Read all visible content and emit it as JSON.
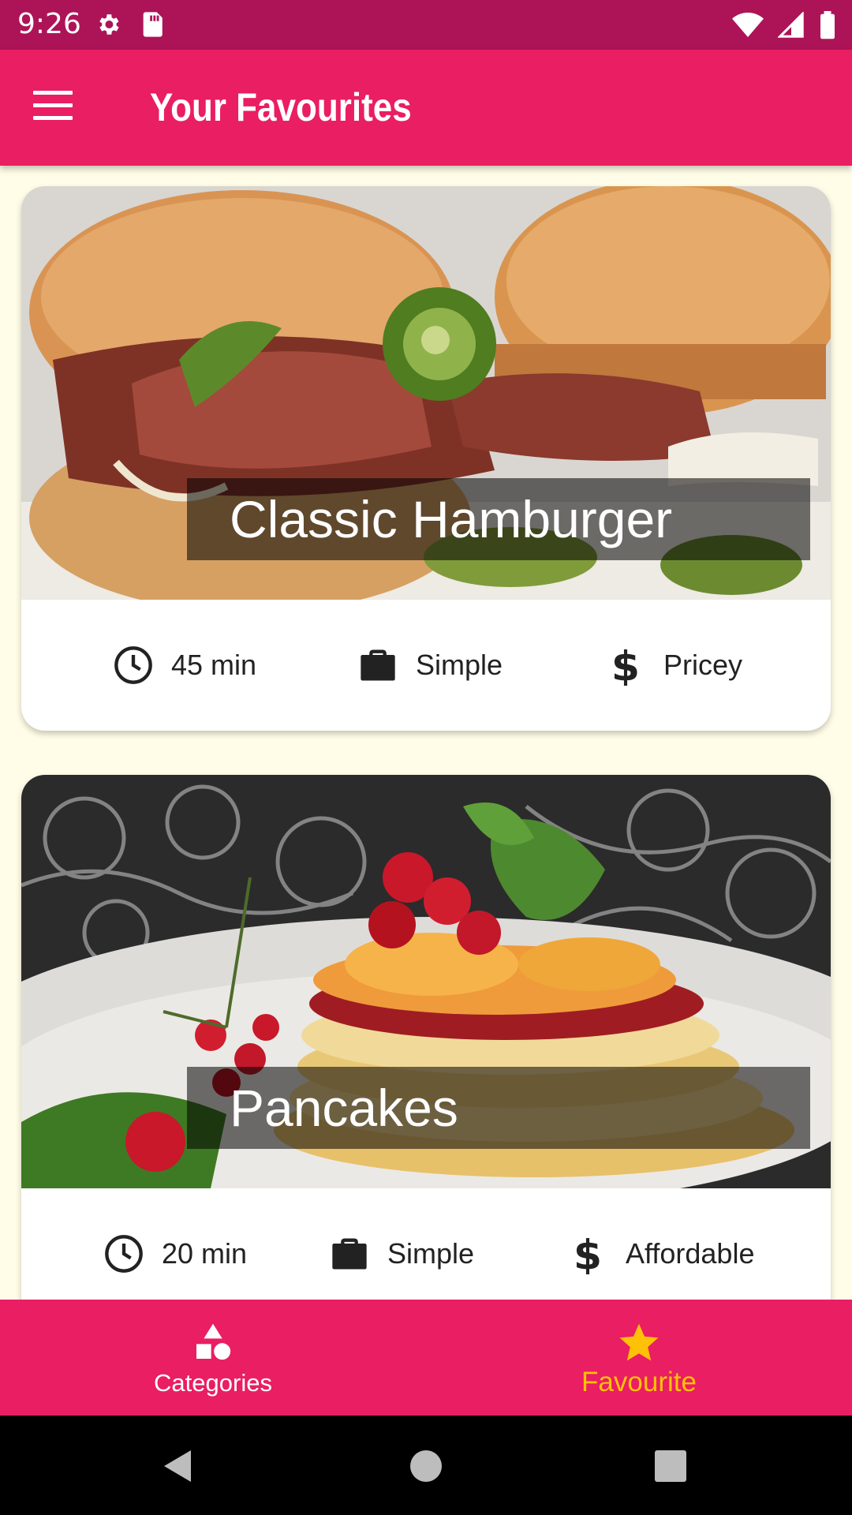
{
  "status_bar": {
    "time": "9:26",
    "icons_left": [
      "settings-icon",
      "sd-card-icon"
    ],
    "icons_right": [
      "wifi-icon",
      "signal-icon",
      "battery-icon"
    ]
  },
  "app_bar": {
    "title": "Your Favourites",
    "menu_icon": "hamburger-menu-icon"
  },
  "meals": [
    {
      "title": "Classic Hamburger",
      "duration": "45 min",
      "complexity": "Simple",
      "affordability": "Pricey"
    },
    {
      "title": "Pancakes",
      "duration": "20 min",
      "complexity": "Simple",
      "affordability": "Affordable"
    }
  ],
  "bottom_nav": {
    "items": [
      {
        "label": "Categories",
        "icon": "category-shapes-icon",
        "active": false
      },
      {
        "label": "Favourite",
        "icon": "star-icon",
        "active": true
      }
    ]
  },
  "system_nav": [
    "back-icon",
    "home-icon",
    "recents-icon"
  ],
  "colors": {
    "primary": "#e91e63",
    "primary_dark": "#ad1457",
    "accent": "#ffc107",
    "background": "#fffde7"
  }
}
